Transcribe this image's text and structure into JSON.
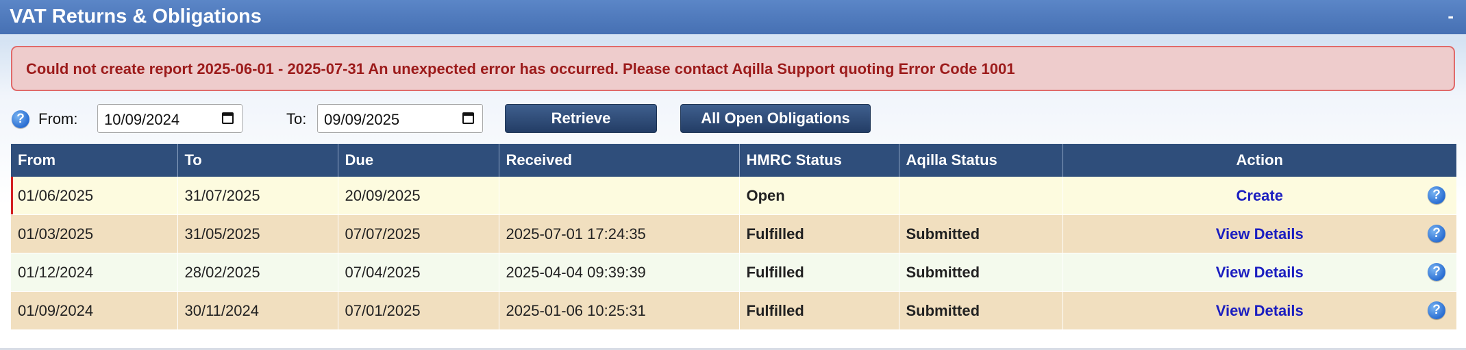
{
  "panel": {
    "title": "VAT Returns & Obligations",
    "collapse_symbol": "-"
  },
  "error": {
    "message": "Could not create report 2025-06-01 - 2025-07-31 An unexpected error has occurred. Please contact Aqilla Support quoting Error Code 1001"
  },
  "filter": {
    "help_icon": "help-icon",
    "from_label": "From:",
    "from_value": "10/09/2024",
    "to_label": "To:",
    "to_value": "09/09/2025",
    "retrieve_label": "Retrieve",
    "all_open_label": "All Open Obligations"
  },
  "table": {
    "columns": [
      "From",
      "To",
      "Due",
      "Received",
      "HMRC Status",
      "Aqilla Status",
      "Action"
    ],
    "rows": [
      {
        "from": "01/06/2025",
        "to": "31/07/2025",
        "due": "20/09/2025",
        "received": "",
        "hmrc_status": "Open",
        "aqilla_status": "",
        "action": "Create"
      },
      {
        "from": "01/03/2025",
        "to": "31/05/2025",
        "due": "07/07/2025",
        "received": "2025-07-01 17:24:35",
        "hmrc_status": "Fulfilled",
        "aqilla_status": "Submitted",
        "action": "View Details"
      },
      {
        "from": "01/12/2024",
        "to": "28/02/2025",
        "due": "07/04/2025",
        "received": "2025-04-04 09:39:39",
        "hmrc_status": "Fulfilled",
        "aqilla_status": "Submitted",
        "action": "View Details"
      },
      {
        "from": "01/09/2024",
        "to": "30/11/2024",
        "due": "07/01/2025",
        "received": "2025-01-06 10:25:31",
        "hmrc_status": "Fulfilled",
        "aqilla_status": "Submitted",
        "action": "View Details"
      }
    ]
  },
  "colors": {
    "title_bar": "#4a74b8",
    "error_bg": "#eecccc",
    "error_text": "#9c1b1b",
    "header_bg": "#2f4e7b",
    "button_bg": "#2b4572",
    "link": "#1b1ec0",
    "status_green": "#2a7a10",
    "status_open": "#6e5a00"
  }
}
